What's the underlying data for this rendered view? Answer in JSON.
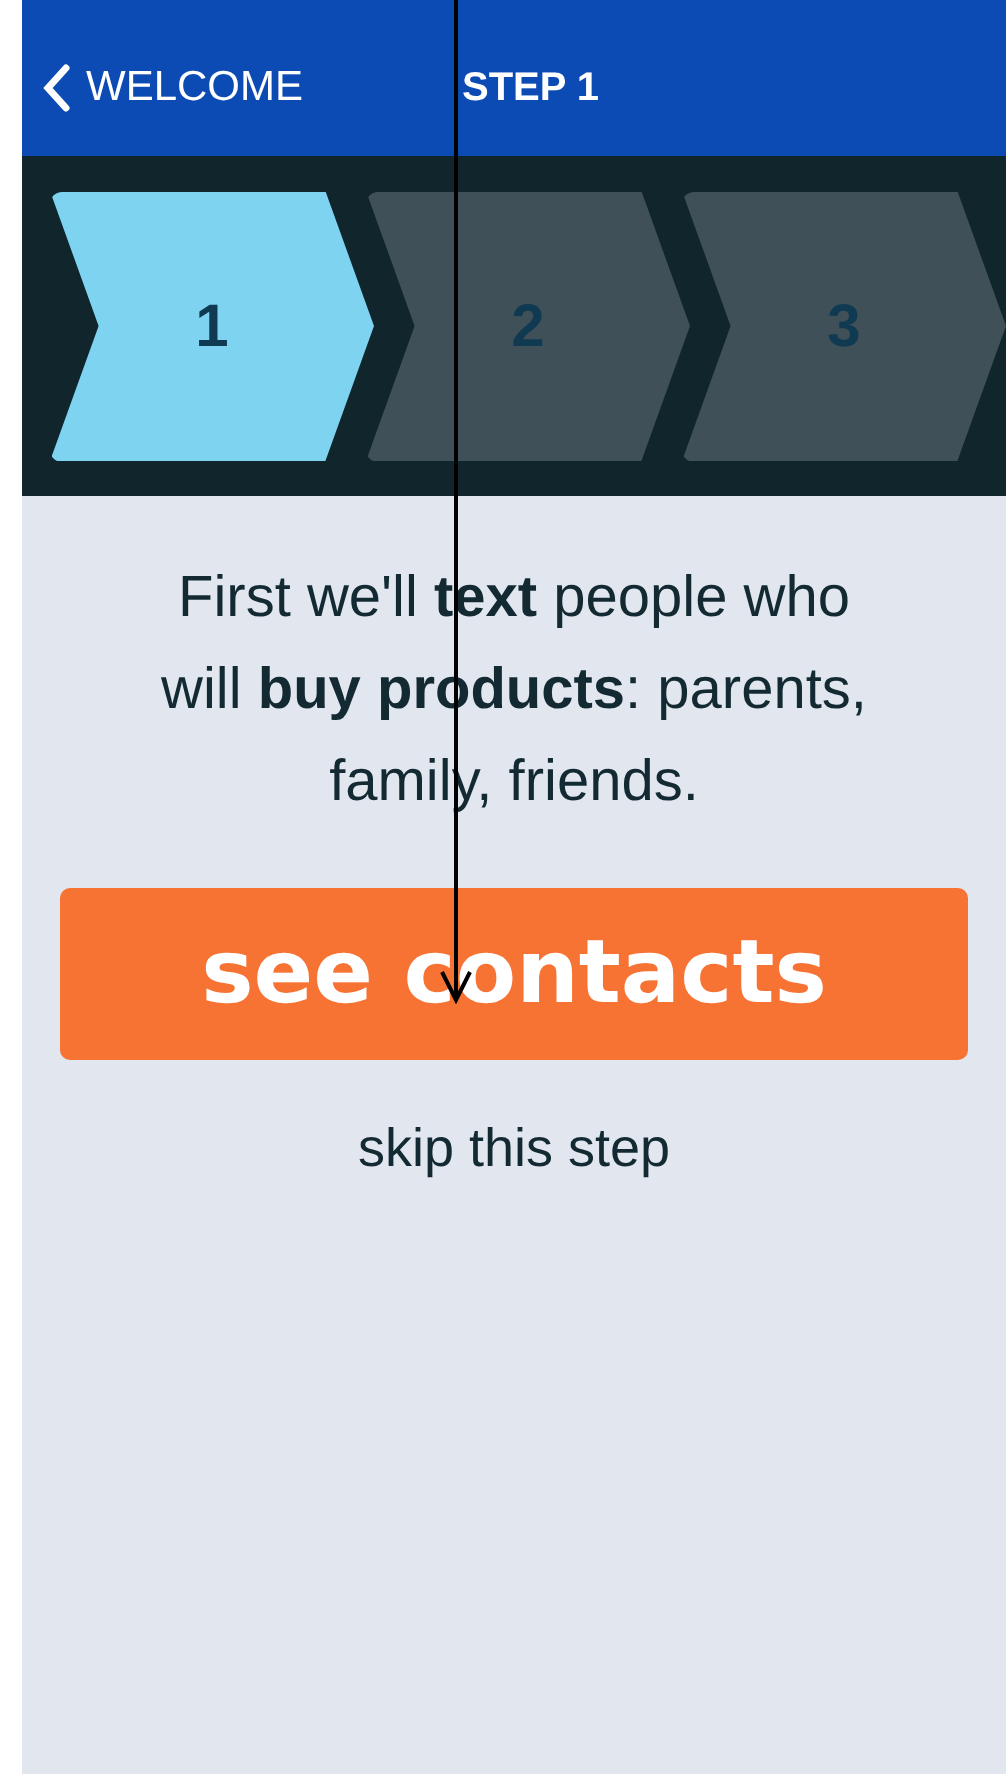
{
  "nav_bar": {
    "back_label": "WELCOME",
    "title": "STEP 1"
  },
  "steps": [
    {
      "label": "1",
      "selected": true
    },
    {
      "label": "2",
      "selected": false
    },
    {
      "label": "3",
      "selected": false
    }
  ],
  "intro_text": "First we'll **text** people who will **buy products**: parents, family, friends.",
  "primary_button": "see contacts",
  "skip_link": "skip this step"
}
